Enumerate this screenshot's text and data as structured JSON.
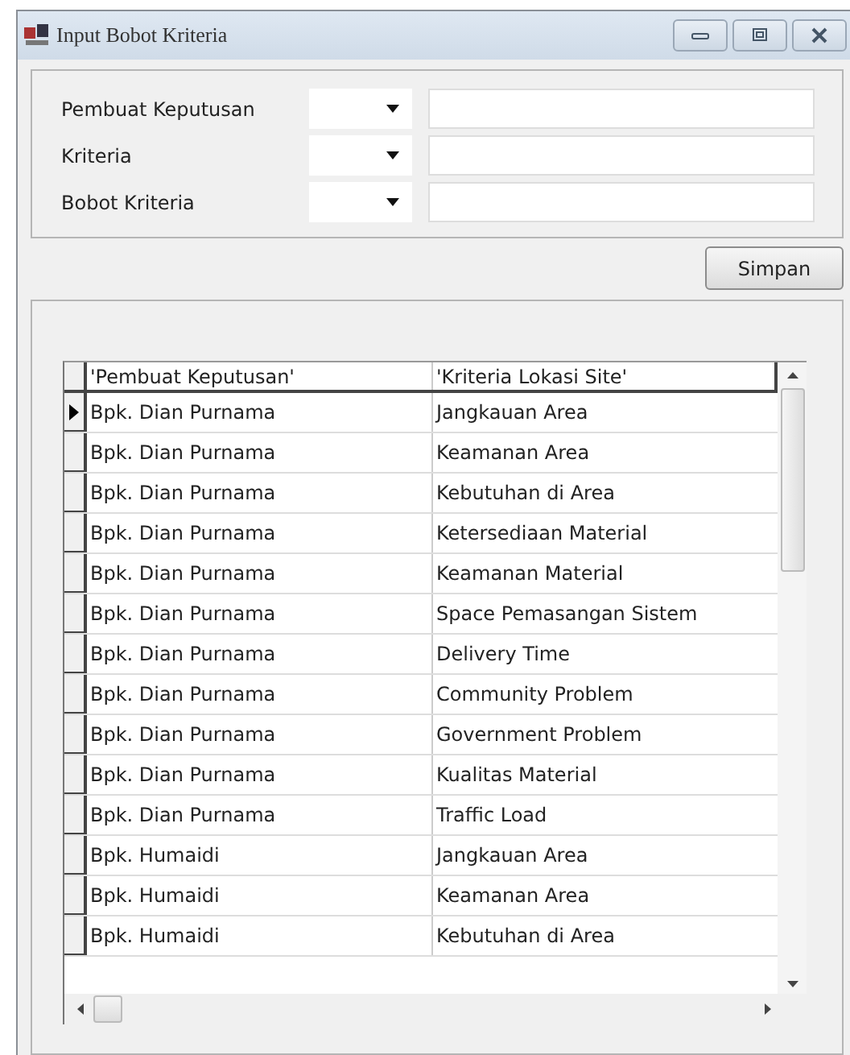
{
  "window": {
    "title": "Input Bobot Kriteria"
  },
  "form": {
    "fields": [
      {
        "label": "Pembuat Keputusan"
      },
      {
        "label": "Kriteria"
      },
      {
        "label": "Bobot Kriteria"
      }
    ],
    "save_button": "Simpan"
  },
  "table": {
    "columns": [
      "'Pembuat Keputusan'",
      "'Kriteria Lokasi Site'"
    ],
    "rows": [
      {
        "cells": [
          "Bpk. Dian Purnama",
          "Jangkauan Area"
        ],
        "selected": true
      },
      {
        "cells": [
          "Bpk. Dian Purnama",
          "Keamanan Area"
        ],
        "selected": false
      },
      {
        "cells": [
          "Bpk. Dian Purnama",
          "Kebutuhan di Area"
        ],
        "selected": false
      },
      {
        "cells": [
          "Bpk. Dian Purnama",
          "Ketersediaan Material"
        ],
        "selected": false
      },
      {
        "cells": [
          "Bpk. Dian Purnama",
          "Keamanan Material"
        ],
        "selected": false
      },
      {
        "cells": [
          "Bpk. Dian Purnama",
          "Space Pemasangan Sistem"
        ],
        "selected": false
      },
      {
        "cells": [
          "Bpk. Dian Purnama",
          "Delivery Time"
        ],
        "selected": false
      },
      {
        "cells": [
          "Bpk. Dian Purnama",
          "Community Problem"
        ],
        "selected": false
      },
      {
        "cells": [
          "Bpk. Dian Purnama",
          "Government Problem"
        ],
        "selected": false
      },
      {
        "cells": [
          "Bpk. Dian Purnama",
          "Kualitas Material"
        ],
        "selected": false
      },
      {
        "cells": [
          "Bpk. Dian Purnama",
          "Traffic Load"
        ],
        "selected": false
      },
      {
        "cells": [
          "Bpk. Humaidi",
          "Jangkauan Area"
        ],
        "selected": false
      },
      {
        "cells": [
          "Bpk. Humaidi",
          "Keamanan Area"
        ],
        "selected": false
      },
      {
        "cells": [
          "Bpk. Humaidi",
          "Kebutuhan di Area"
        ],
        "selected": false
      }
    ]
  }
}
